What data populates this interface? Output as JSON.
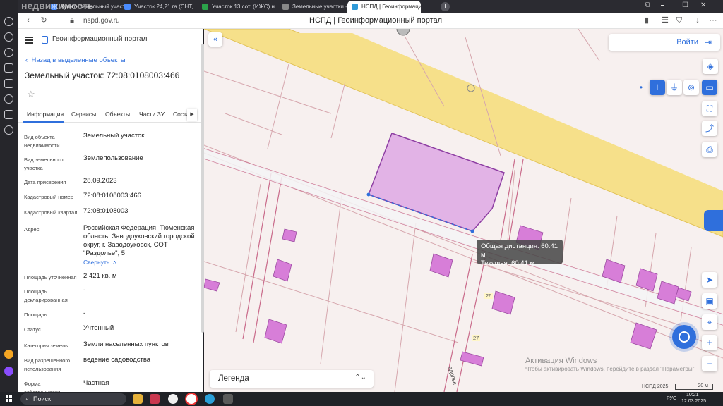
{
  "browser": {
    "tabs": [
      {
        "label": "Купить земельный участ",
        "active": false
      },
      {
        "label": "Участок 24,21 га (СНТ, ДН",
        "active": false
      },
      {
        "label": "Участок 13 сот. (ИЖС) на",
        "active": false
      },
      {
        "label": "Земельные участки - Reali",
        "active": false
      },
      {
        "label": "НСПД | Геоинформацио",
        "active": true
      }
    ],
    "url": "nspd.gov.ru",
    "page_title": "НСПД | Геоинформационный портал",
    "overlay_watermark": "недвижимость"
  },
  "header": {
    "portal_name": "Геоинформационный портал"
  },
  "panel": {
    "back_link": "Назад в выделенные объекты",
    "title": "Земельный участок: 72:08:0108003:466",
    "tabs": [
      "Информация",
      "Сервисы",
      "Объекты",
      "Части ЗУ",
      "Соста"
    ],
    "rows": [
      {
        "label": "Вид объекта недвижимости",
        "value": "Земельный участок"
      },
      {
        "label": "Вид земельного участка",
        "value": "Землепользование"
      },
      {
        "label": "Дата присвоения",
        "value": "28.09.2023"
      },
      {
        "label": "Кадастровый номер",
        "value": "72:08:0108003:466"
      },
      {
        "label": "Кадастровый квартал",
        "value": "72:08:0108003"
      },
      {
        "label": "Адрес",
        "value": "Российская Федерация, Тюменская область, Заводоуковский городской округ, г. Заводоуковск, СОТ \"Раздолье\", 5"
      },
      {
        "label": "Площадь уточненная",
        "value": "2 421 кв. м"
      },
      {
        "label": "Площадь декларированная",
        "value": "-"
      },
      {
        "label": "Площадь",
        "value": "-"
      },
      {
        "label": "Статус",
        "value": "Учтенный"
      },
      {
        "label": "Категория земель",
        "value": "Земли населенных пунктов"
      },
      {
        "label": "Вид разрешенного использования",
        "value": "ведение садоводства"
      },
      {
        "label": "Форма собственности",
        "value": "Частная"
      }
    ],
    "collapse_link": "Свернуть"
  },
  "map": {
    "login_label": "Войти",
    "measure": {
      "total": "Общая дистанция: 60.41 м",
      "current": "Текущая: 60.41 м"
    },
    "legend_label": "Легенда",
    "house_numbers": [
      "26",
      "27"
    ],
    "street_fragment": "адолье",
    "watermark_title": "Активация Windows",
    "watermark_sub": "Чтобы активировать Windows, перейдите в раздел \"Параметры\".",
    "credit": "НСПД 2025",
    "scale_label": "20 м",
    "colors": {
      "accent": "#2f6fdc",
      "selected_parcel_fill": "#e2b3e6",
      "selected_parcel_stroke": "#8e3fa3",
      "building_fill": "#d77ed8",
      "road_fill": "#f6e08a"
    }
  },
  "taskbar": {
    "search_label": "Поиск",
    "language": "РУС",
    "time": "10:21",
    "date": "12.03.2025"
  }
}
